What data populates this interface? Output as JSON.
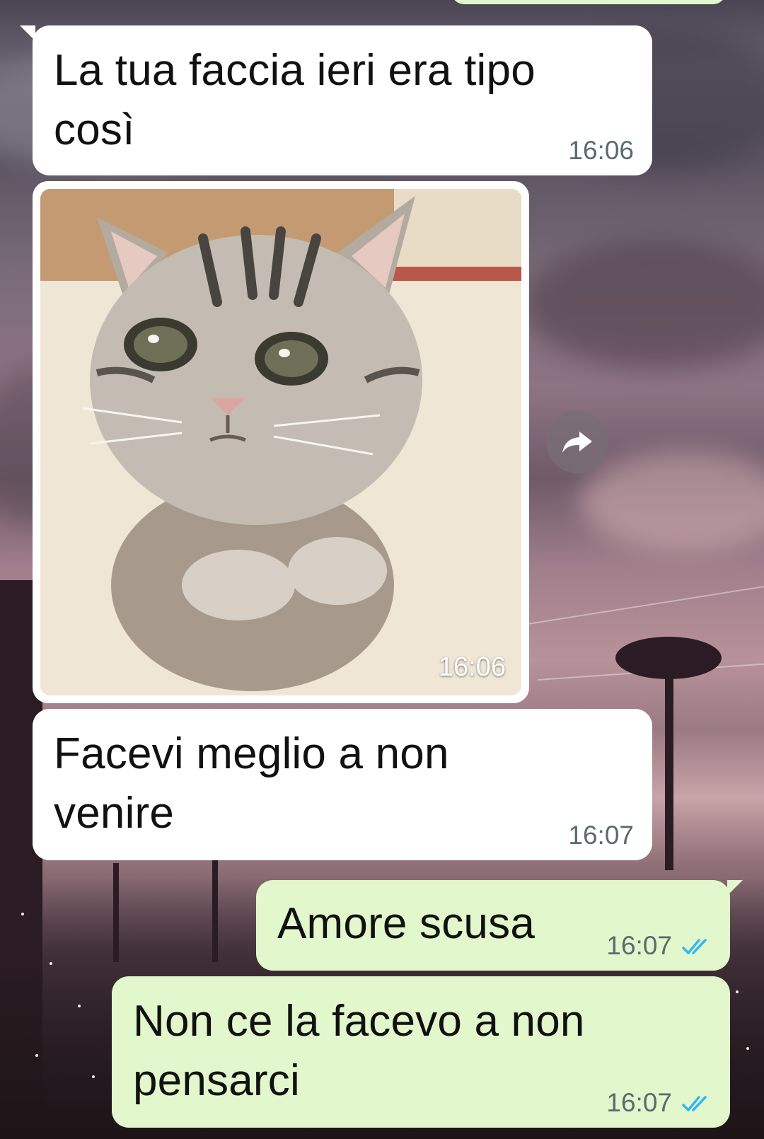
{
  "chat": {
    "messages": [
      {
        "direction": "incoming",
        "type": "text",
        "text": "La tua faccia ieri era tipo\ncosì",
        "time": "16:06"
      },
      {
        "direction": "incoming",
        "type": "image",
        "image_subject": "sad-cat-photo",
        "time": "16:06"
      },
      {
        "direction": "incoming",
        "type": "text",
        "text": "Facevi meglio a non\nvenire",
        "time": "16:07"
      },
      {
        "direction": "outgoing",
        "type": "text",
        "text": "Amore scusa",
        "time": "16:07",
        "status": "read"
      },
      {
        "direction": "outgoing",
        "type": "text",
        "text": "Non ce la facevo a non\npensarci",
        "time": "16:07",
        "status": "read"
      }
    ]
  },
  "icons": {
    "forward": "forward-arrow-icon",
    "read_receipt": "double-check-icon"
  },
  "colors": {
    "incoming_bubble": "#ffffff",
    "outgoing_bubble": "#e2f7cb",
    "timestamp": "#5a6a70",
    "read_ticks": "#34b7f1"
  }
}
